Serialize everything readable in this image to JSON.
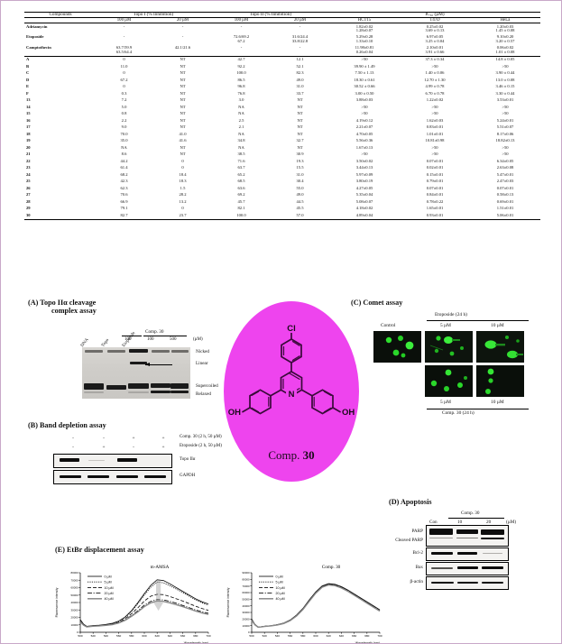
{
  "table": {
    "col_compounds": "Compounds",
    "group_topo1": "Topo I (% Inhibition)",
    "group_topo2": "Topo II (% Inhibition)",
    "group_ic50": "IC₅₀ (µM)",
    "sub_100": "100 µM",
    "sub_20": "20 µM",
    "cell_hct15": "HCT15",
    "cell_t47d": "T47D",
    "cell_hela": "HeLa",
    "ref_rows": [
      {
        "name": "Adriamycin",
        "t1_100": "-",
        "t1_20": "-",
        "t2_100": "-",
        "t2_20": "-",
        "hct15": [
          "1.82±0.02",
          "1.28±0.07"
        ],
        "t47d": [
          "0.25±0.02",
          "3.69 ± 0.13"
        ],
        "hela": [
          "1.20±0.03",
          "1.45 ± 0.08"
        ]
      },
      {
        "name": "Etoposide",
        "t1_100": "-",
        "t1_20": "-",
        "t2_100": [
          "72.6/69.2",
          "67.2"
        ],
        "t2_20": [
          "31.6/24.4",
          "33.8/22.8"
        ],
        "hct15": [
          "5.29±0.28",
          "1.33±0.10"
        ],
        "t47d": [
          "6.97±0.05",
          "3.25 ± 0.04"
        ],
        "hela": [
          "9.10±0.20",
          "3.20 ± 0.57"
        ]
      },
      {
        "name": "Camptothecin",
        "t1_100": [
          "63.7/59.9",
          "63.5/64.4"
        ],
        "t1_20": [
          "42.1/21.6"
        ],
        "t2_100": "-",
        "t2_20": "-",
        "hct15": [
          "11.98±0.81",
          "0.26±0.04"
        ],
        "t47d": [
          "2.10±0.01",
          "3.91 ± 0.66"
        ],
        "hela": [
          "0.06±0.02",
          "1.01 ± 0.08"
        ]
      }
    ],
    "rows": [
      {
        "name": "A",
        "t1_100": "0",
        "t1_20": "NT",
        "t2_100": "42.7",
        "t2_20": "12.1",
        "hct15": ">50",
        "t47d": "37.3 ± 0.34",
        "hela": "14.8 ± 0.05"
      },
      {
        "name": "B",
        "t1_100": "11.0",
        "t1_20": "NT",
        "t2_100": "92.2",
        "t2_20": "52.1",
        "hct15": "39.90 ± 1.49",
        "t47d": ">50",
        "hela": ">50"
      },
      {
        "name": "C",
        "t1_100": "0",
        "t1_20": "NT",
        "t2_100": "100.0",
        "t2_20": "82.3",
        "hct15": "7.50 ± 1.13",
        "t47d": "1.40 ± 0.06",
        "hela": "3.90 ± 0.44"
      },
      {
        "name": "D",
        "t1_100": "67.2",
        "t1_20": "NT",
        "t2_100": "86.5",
        "t2_20": "49.0",
        "hct15": "18.30 ± 0.61",
        "t47d": "12.70 ± 1.30",
        "hela": "13.0 ± 0.08"
      },
      {
        "name": "E",
        "t1_100": "0",
        "t1_20": "NT",
        "t2_100": "96.8",
        "t2_20": "31.0",
        "hct15": "30.52 ± 0.66",
        "t47d": "4.99 ± 0.78",
        "hela": "3.46 ± 0.15"
      },
      {
        "name": "F",
        "t1_100": "0.3",
        "t1_20": "NT",
        "t2_100": "76.8",
        "t2_20": "33.7",
        "hct15": "3.00 ± 0.50",
        "t47d": "6.70 ± 0.78",
        "hela": "3.30 ± 0.44"
      },
      {
        "name": "13",
        "t1_100": "7.2",
        "t1_20": "NT",
        "t2_100": "3.0",
        "t2_20": "NT",
        "hct15": "3.88±0.03",
        "t47d": "1.22±0.02",
        "hela": "3.53±0.01"
      },
      {
        "name": "14",
        "t1_100": "5.0",
        "t1_20": "NT",
        "t2_100": "NA",
        "t2_20": "NT",
        "hct15": ">50",
        "t47d": ">50",
        "hela": ">50"
      },
      {
        "name": "15",
        "t1_100": "0.8",
        "t1_20": "NT",
        "t2_100": "NA",
        "t2_20": "NT",
        "hct15": ">50",
        "t47d": ">50",
        "hela": ">50"
      },
      {
        "name": "16",
        "t1_100": "2.2",
        "t1_20": "NT",
        "t2_100": "2.5",
        "t2_20": "NT",
        "hct15": "4.19±0.12",
        "t47d": "1.62±0.03",
        "hela": "5.24±0.01"
      },
      {
        "name": "17",
        "t1_100": "9.0",
        "t1_20": "NT",
        "t2_100": "2.1",
        "t2_20": "NT",
        "hct15": "2.21±0.07",
        "t47d": "0.83±0.01",
        "hela": "5.51±0.07"
      },
      {
        "name": "18",
        "t1_100": "70.0",
        "t1_20": "41.0",
        "t2_100": "NA",
        "t2_20": "NT",
        "hct15": "4.70±0.05",
        "t47d": "1.01±0.01",
        "hela": "8.17±0.06"
      },
      {
        "name": "19",
        "t1_100": "35.0",
        "t1_20": "41.6",
        "t2_100": "34.8",
        "t2_20": "32.7",
        "hct15": "5.56±0.36",
        "t47d": "10.81±0.98",
        "hela": "18.82±0.13"
      },
      {
        "name": "20",
        "t1_100": "NA",
        "t1_20": "NT",
        "t2_100": "NA",
        "t2_20": "NT",
        "hct15": "1.67±0.13",
        "t47d": ">50",
        "hela": ">50"
      },
      {
        "name": "21",
        "t1_100": "8.6",
        "t1_20": "NT",
        "t2_100": "38.5",
        "t2_20": "30.9",
        "hct15": ">50",
        "t47d": ">50",
        "hela": ">50"
      },
      {
        "name": "22",
        "t1_100": "44.2",
        "t1_20": "0",
        "t2_100": "71.6",
        "t2_20": "19.3",
        "hct15": "3.50±0.02",
        "t47d": "0.07±0.01",
        "hela": "6.34±0.05"
      },
      {
        "name": "23",
        "t1_100": "61.4",
        "t1_20": "0",
        "t2_100": "63.7",
        "t2_20": "15.5",
        "hct15": "3.44±0.13",
        "t47d": "0.02±0.01",
        "hela": "2.63±0.08"
      },
      {
        "name": "24",
        "t1_100": "68.2",
        "t1_20": "18.4",
        "t2_100": "65.2",
        "t2_20": "31.0",
        "hct15": "5.97±0.09",
        "t47d": "0.15±0.01",
        "hela": "5.47±0.01"
      },
      {
        "name": "25",
        "t1_100": "42.3",
        "t1_20": "18.3",
        "t2_100": "68.5",
        "t2_20": "30.4",
        "hct15": "3.80±0.19",
        "t47d": "0.79±0.01",
        "hela": "2.47±0.03"
      },
      {
        "name": "26",
        "t1_100": "62.3",
        "t1_20": "1.5",
        "t2_100": "63.6",
        "t2_20": "55.0",
        "hct15": "4.27±0.05",
        "t47d": "0.07±0.01",
        "hela": "0.07±0.01"
      },
      {
        "name": "27",
        "t1_100": "70.6",
        "t1_20": "28.2",
        "t2_100": "69.2",
        "t2_20": "49.0",
        "hct15": "5.35±0.04",
        "t47d": "0.84±0.01",
        "hela": "0.58±0.13"
      },
      {
        "name": "28",
        "t1_100": "66.9",
        "t1_20": "13.2",
        "t2_100": "45.7",
        "t2_20": "44.5",
        "hct15": "5.08±0.07",
        "t47d": "0.78±0.22",
        "hela": "0.69±0.01"
      },
      {
        "name": "29",
        "t1_100": "79.1",
        "t1_20": "0",
        "t2_100": "82.1",
        "t2_20": "45.5",
        "hct15": "4.18±0.02",
        "t47d": "1.65±0.01",
        "hela": "1.51±0.01"
      },
      {
        "name": "30",
        "t1_100": "82.7",
        "t1_20": "23.7",
        "t2_100": "100.0",
        "t2_20": "57.0",
        "hct15": "4.89±0.04",
        "t47d": "0.93±0.01",
        "hela": "5.06±0.01"
      }
    ]
  },
  "panelA": {
    "title_line1": "(A) Topo IIα cleavage",
    "title_line2": "complex assay",
    "lanes": [
      "DNA",
      "Topo",
      "Etoposide"
    ],
    "group_label": "Comp. 30",
    "conc": [
      "100",
      "100",
      "500"
    ],
    "unit": "(µM)",
    "bands": [
      "Nicked",
      "Linear",
      "Supercoiled",
      "Relaxed"
    ]
  },
  "panelB": {
    "title": "(B) Band depletion assay",
    "row1_signs": [
      "-",
      "-",
      "+",
      "+"
    ],
    "row1_label": "Comp. 30 (2 h, 50 µM)",
    "row2_signs": [
      "-",
      "+",
      "-",
      "+"
    ],
    "row2_label": "Etoposide (2 h, 50 µM)",
    "blot1": "Topo IIα",
    "blot2": "GAPDH"
  },
  "molecule": {
    "name_prefix": "Comp. ",
    "name_number": "30",
    "atom_cl": "Cl",
    "atom_n": "N",
    "atom_oh_left": "OH",
    "atom_oh_right": "OH",
    "bg_color": "#ee44ee"
  },
  "panelC": {
    "title": "(C) Comet assay",
    "control": "Control",
    "top_header": "Etoposide (24 h)",
    "top_doses": [
      "5 µM",
      "10 µM"
    ],
    "bottom_doses": [
      "5 µM",
      "10 µM"
    ],
    "bottom_header": "Comp. 30 (24 h)"
  },
  "panelD": {
    "title": "(D) Apoptosis",
    "group_label": "Comp. 30",
    "cols": [
      "Con",
      "10",
      "20"
    ],
    "unit": "(µM)",
    "rows": [
      "PARP",
      "Cleaved PARP",
      "Bcl-2",
      "Bax",
      "β-actin"
    ]
  },
  "panelE": {
    "title": "(E) EtBr displacement assay"
  },
  "chart_data": [
    {
      "type": "line",
      "title": "m-AMSA",
      "xlabel": "Wavelength (nm)",
      "ylabel": "Fluorescence intensity",
      "xlim": [
        500,
        700
      ],
      "ylim": [
        0,
        80000
      ],
      "xticks": [
        500,
        520,
        540,
        560,
        580,
        600,
        620,
        640,
        660,
        680,
        700
      ],
      "yticks": [
        0,
        10000,
        20000,
        30000,
        40000,
        50000,
        60000,
        70000,
        80000
      ],
      "legend_position": "top-left",
      "annotation": "down-arrow",
      "x": [
        500,
        505,
        510,
        515,
        520,
        530,
        540,
        550,
        560,
        570,
        580,
        590,
        600,
        610,
        620,
        630,
        640,
        650,
        660,
        670,
        680,
        690,
        700
      ],
      "series": [
        {
          "name": "0 µM",
          "style": "solid",
          "values": [
            17000,
            11000,
            8000,
            8500,
            9000,
            9500,
            10500,
            12000,
            15000,
            20500,
            29000,
            40000,
            52000,
            63000,
            70500,
            69500,
            65000,
            60000,
            55000,
            50000,
            45000,
            41000,
            38000
          ]
        },
        {
          "name": "5 µM",
          "style": "dotted",
          "values": [
            16500,
            10500,
            7800,
            8200,
            8800,
            9300,
            10200,
            11600,
            14500,
            19800,
            28000,
            38500,
            50000,
            60500,
            67500,
            66500,
            62500,
            58000,
            53500,
            48500,
            43500,
            39500,
            36500
          ]
        },
        {
          "name": "10 µM",
          "style": "dashed",
          "values": [
            15000,
            10000,
            7500,
            8000,
            8500,
            9000,
            9800,
            11000,
            13500,
            18000,
            25000,
            33000,
            42000,
            48500,
            51000,
            50500,
            48000,
            45000,
            42000,
            38500,
            35000,
            32000,
            29500
          ]
        },
        {
          "name": "20 µM",
          "style": "dashdot",
          "values": [
            14500,
            9800,
            7300,
            7800,
            8300,
            8800,
            9500,
            10600,
            12800,
            16800,
            22500,
            29000,
            36500,
            41500,
            44000,
            43500,
            41500,
            39000,
            36000,
            33000,
            30000,
            27500,
            25500
          ]
        },
        {
          "name": "40 µM",
          "style": "thick-gray",
          "values": [
            14000,
            9600,
            7200,
            7600,
            8100,
            8600,
            9300,
            10300,
            12400,
            16000,
            21500,
            27500,
            34500,
            39500,
            42000,
            41500,
            39500,
            37000,
            34500,
            31500,
            28500,
            26000,
            24000
          ]
        }
      ]
    },
    {
      "type": "line",
      "title": "Comp. 30",
      "xlabel": "Wavelength (nm)",
      "ylabel": "Fluorescence intensity",
      "xlim": [
        500,
        700
      ],
      "ylim": [
        0,
        90000
      ],
      "xticks": [
        500,
        520,
        540,
        560,
        580,
        600,
        620,
        640,
        660,
        680,
        700
      ],
      "yticks": [
        0,
        10000,
        20000,
        30000,
        40000,
        50000,
        60000,
        70000,
        80000,
        90000
      ],
      "legend_position": "top-left",
      "annotation": "none",
      "x": [
        500,
        505,
        510,
        515,
        520,
        530,
        540,
        550,
        560,
        570,
        580,
        590,
        600,
        610,
        620,
        630,
        640,
        650,
        660,
        670,
        680,
        690,
        700
      ],
      "series": [
        {
          "name": "0 µM",
          "style": "solid",
          "values": [
            20000,
            12000,
            8000,
            8500,
            9200,
            10000,
            11500,
            14000,
            18500,
            26000,
            36000,
            49000,
            61000,
            70000,
            73500,
            72500,
            69000,
            64000,
            58000,
            52000,
            46000,
            40000,
            34000
          ]
        },
        {
          "name": "5 µM",
          "style": "dotted",
          "values": [
            19500,
            11800,
            7900,
            8400,
            9100,
            9900,
            11400,
            13800,
            18200,
            25500,
            35500,
            48500,
            60500,
            69500,
            73000,
            72000,
            68500,
            63500,
            57500,
            51500,
            45500,
            39500,
            33500
          ]
        },
        {
          "name": "10 µM",
          "style": "dashed",
          "values": [
            19000,
            11600,
            7800,
            8300,
            9000,
            9800,
            11300,
            13600,
            18000,
            25200,
            35000,
            48000,
            60000,
            69000,
            72500,
            71500,
            68000,
            63000,
            57000,
            51000,
            45000,
            39000,
            33000
          ]
        },
        {
          "name": "20 µM",
          "style": "dashdot",
          "values": [
            18500,
            11400,
            7700,
            8200,
            8900,
            9700,
            11200,
            13400,
            17800,
            25000,
            34800,
            47500,
            59500,
            68500,
            72000,
            71000,
            67500,
            62500,
            56500,
            50500,
            44500,
            38500,
            32500
          ]
        },
        {
          "name": "40 µM",
          "style": "thick-gray",
          "values": [
            18000,
            11200,
            7600,
            8100,
            8800,
            9600,
            11000,
            13200,
            17500,
            24600,
            34400,
            47000,
            59000,
            68000,
            71500,
            70500,
            67000,
            62000,
            56000,
            50000,
            44000,
            38000,
            32000
          ]
        }
      ]
    }
  ]
}
